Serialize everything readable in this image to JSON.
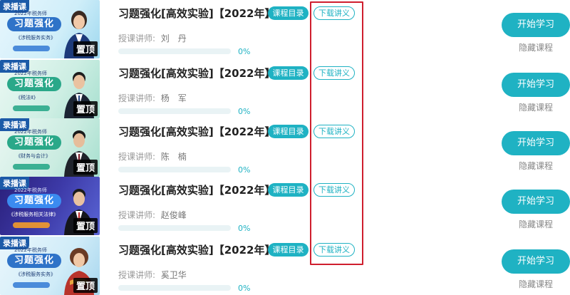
{
  "courses": [
    {
      "title": "习题强化[高效实验]【2022年】",
      "rec_tag": "录播课",
      "thumb_year": "2022年税务师",
      "thumb_title": "习题强化",
      "thumb_sub": "《涉税服务实务》",
      "pin_label": "置顶",
      "catalog_label": "课程目录",
      "download_label": "下载讲义",
      "teacher_prefix": "授课讲师:",
      "teacher_name": "刘　丹",
      "progress": 0,
      "progress_text": "0%",
      "start_label": "开始学习",
      "hide_label": "隐藏课程",
      "thumb_color": "#dff3fb"
    },
    {
      "title": "习题强化[高效实验]【2022年】",
      "rec_tag": "录播课",
      "thumb_year": "2022年税务师",
      "thumb_title": "习题强化",
      "thumb_sub": "《税法Ⅱ》",
      "pin_label": "置顶",
      "catalog_label": "课程目录",
      "download_label": "下载讲义",
      "teacher_prefix": "授课讲师:",
      "teacher_name": "杨　军",
      "progress": 0,
      "progress_text": "0%",
      "start_label": "开始学习",
      "hide_label": "隐藏课程",
      "thumb_color": "#e4f6f1"
    },
    {
      "title": "习题强化[高效实验]【2022年】",
      "rec_tag": "录播课",
      "thumb_year": "2022年税务师",
      "thumb_title": "习题强化",
      "thumb_sub": "《财务与会计》",
      "pin_label": "置顶",
      "catalog_label": "课程目录",
      "download_label": "下载讲义",
      "teacher_prefix": "授课讲师:",
      "teacher_name": "陈　楠",
      "progress": 0,
      "progress_text": "0%",
      "start_label": "开始学习",
      "hide_label": "隐藏课程",
      "thumb_color": "#e2f4ee"
    },
    {
      "title": "习题强化[高效实验]【2022年】",
      "rec_tag": "录播课",
      "thumb_year": "2022年税务师",
      "thumb_title": "习题强化",
      "thumb_sub": "《涉税服务相关法律》",
      "pin_label": "置顶",
      "catalog_label": "课程目录",
      "download_label": "下载讲义",
      "teacher_prefix": "授课讲师:",
      "teacher_name": "赵俊峰",
      "progress": 0,
      "progress_text": "0%",
      "start_label": "开始学习",
      "hide_label": "隐藏课程",
      "thumb_color": "#3a2f8f"
    },
    {
      "title": "习题强化[高效实验]【2022年】",
      "rec_tag": "录播课",
      "thumb_year": "2022年税务师",
      "thumb_title": "习题强化",
      "thumb_sub": "《涉税服务实务》",
      "pin_label": "置顶",
      "catalog_label": "课程目录",
      "download_label": "下载讲义",
      "teacher_prefix": "授课讲师:",
      "teacher_name": "奚卫华",
      "progress": 0,
      "progress_text": "0%",
      "start_label": "开始学习",
      "hide_label": "隐藏课程",
      "thumb_color": "#e6f4fb"
    }
  ],
  "colors": {
    "accent": "#1fb2c3",
    "highlight": "#cf1e2e"
  }
}
